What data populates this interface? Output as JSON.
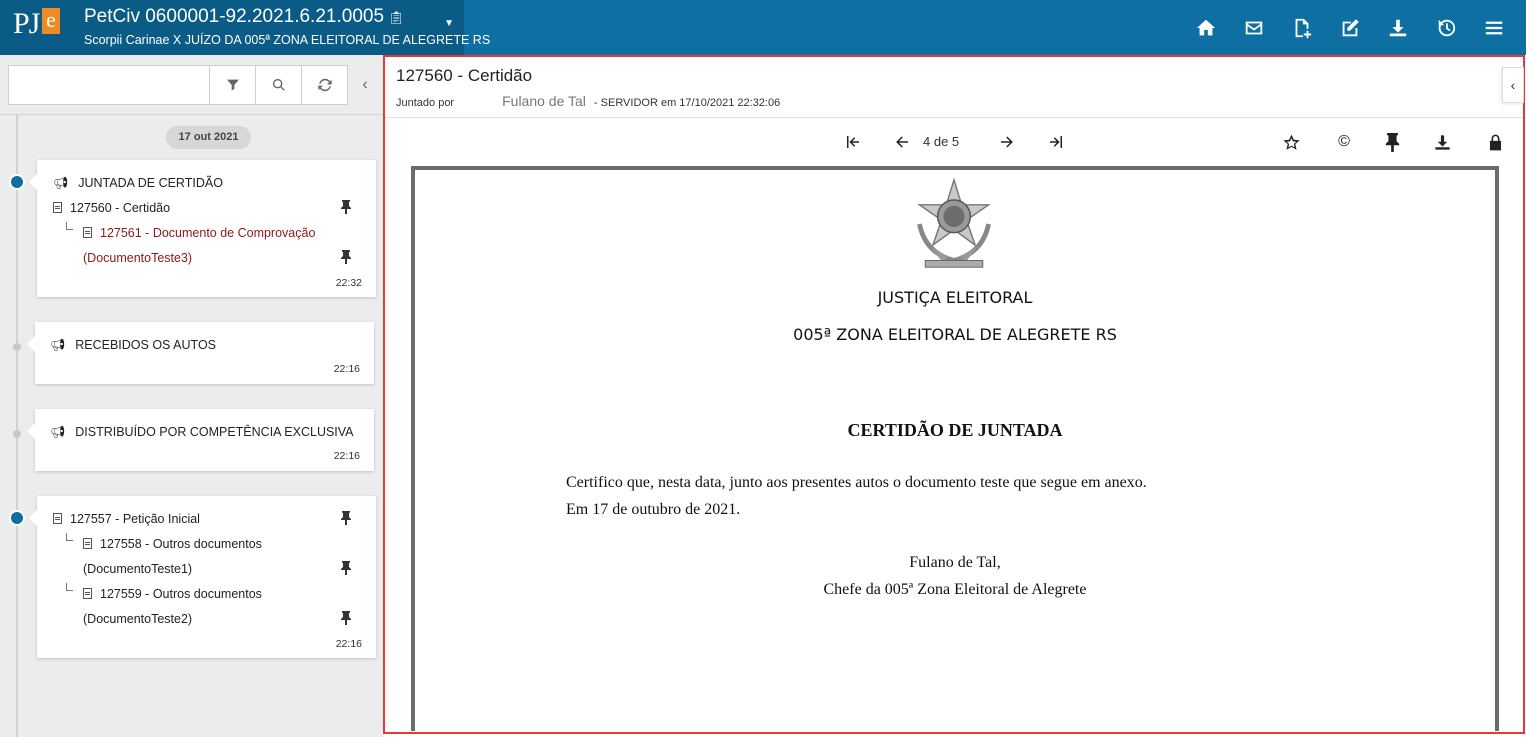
{
  "header": {
    "logo_text": "PJe",
    "case_title": "PetCiv 0600001-92.2021.6.21.0005",
    "case_subtitle": "Scorpii Carinae X JUÍZO DA 005ª ZONA ELEITORAL DE ALEGRETE RS",
    "icons": [
      "home-icon",
      "mail-icon",
      "new-document-icon",
      "edit-icon",
      "download-icon",
      "history-icon",
      "menu-icon"
    ],
    "color": "#0e6fa3"
  },
  "sidebar": {
    "search_placeholder": "",
    "date_label": "17 out 2021",
    "events": [
      {
        "title": "JUNTADA DE CERTIDÃO",
        "docs": [
          {
            "label": "127560 - Certidão"
          },
          {
            "label": "127561 - Documento de Comprovação",
            "label2": "(DocumentoTeste3)"
          }
        ],
        "time": "22:32"
      },
      {
        "title": "RECEBIDOS OS AUTOS",
        "time": "22:16"
      },
      {
        "title": "DISTRIBUÍDO POR COMPETÊNCIA EXCLUSIVA",
        "time": "22:16"
      },
      {
        "docs": [
          {
            "label": "127557 - Petição Inicial"
          },
          {
            "label": "127558 - Outros documentos",
            "label2": "(DocumentoTeste1)"
          },
          {
            "label": "127559 - Outros documentos",
            "label2": "(DocumentoTeste2)"
          }
        ],
        "time": "22:16"
      }
    ]
  },
  "document": {
    "title": "127560 - Certidão",
    "joined_by_label": "Juntado por",
    "author": "Fulano de Tal",
    "meta_suffix": "- SERVIDOR em 17/10/2021 22:32:06",
    "page_indicator": "4 de 5",
    "content": {
      "org_line1": "JUSTIÇA ELEITORAL",
      "org_line2": "005ª ZONA ELEITORAL DE ALEGRETE RS",
      "heading": "CERTIDÃO DE JUNTADA",
      "paragraph1": "Certifico que, nesta data, junto aos presentes autos o documento teste que segue em anexo.",
      "paragraph2": "Em 17 de outubro de 2021.",
      "signature_name": "Fulano de Tal,",
      "signature_role": "Chefe da 005ª Zona Eleitoral de Alegrete"
    }
  },
  "highlight_color": "#e53935"
}
